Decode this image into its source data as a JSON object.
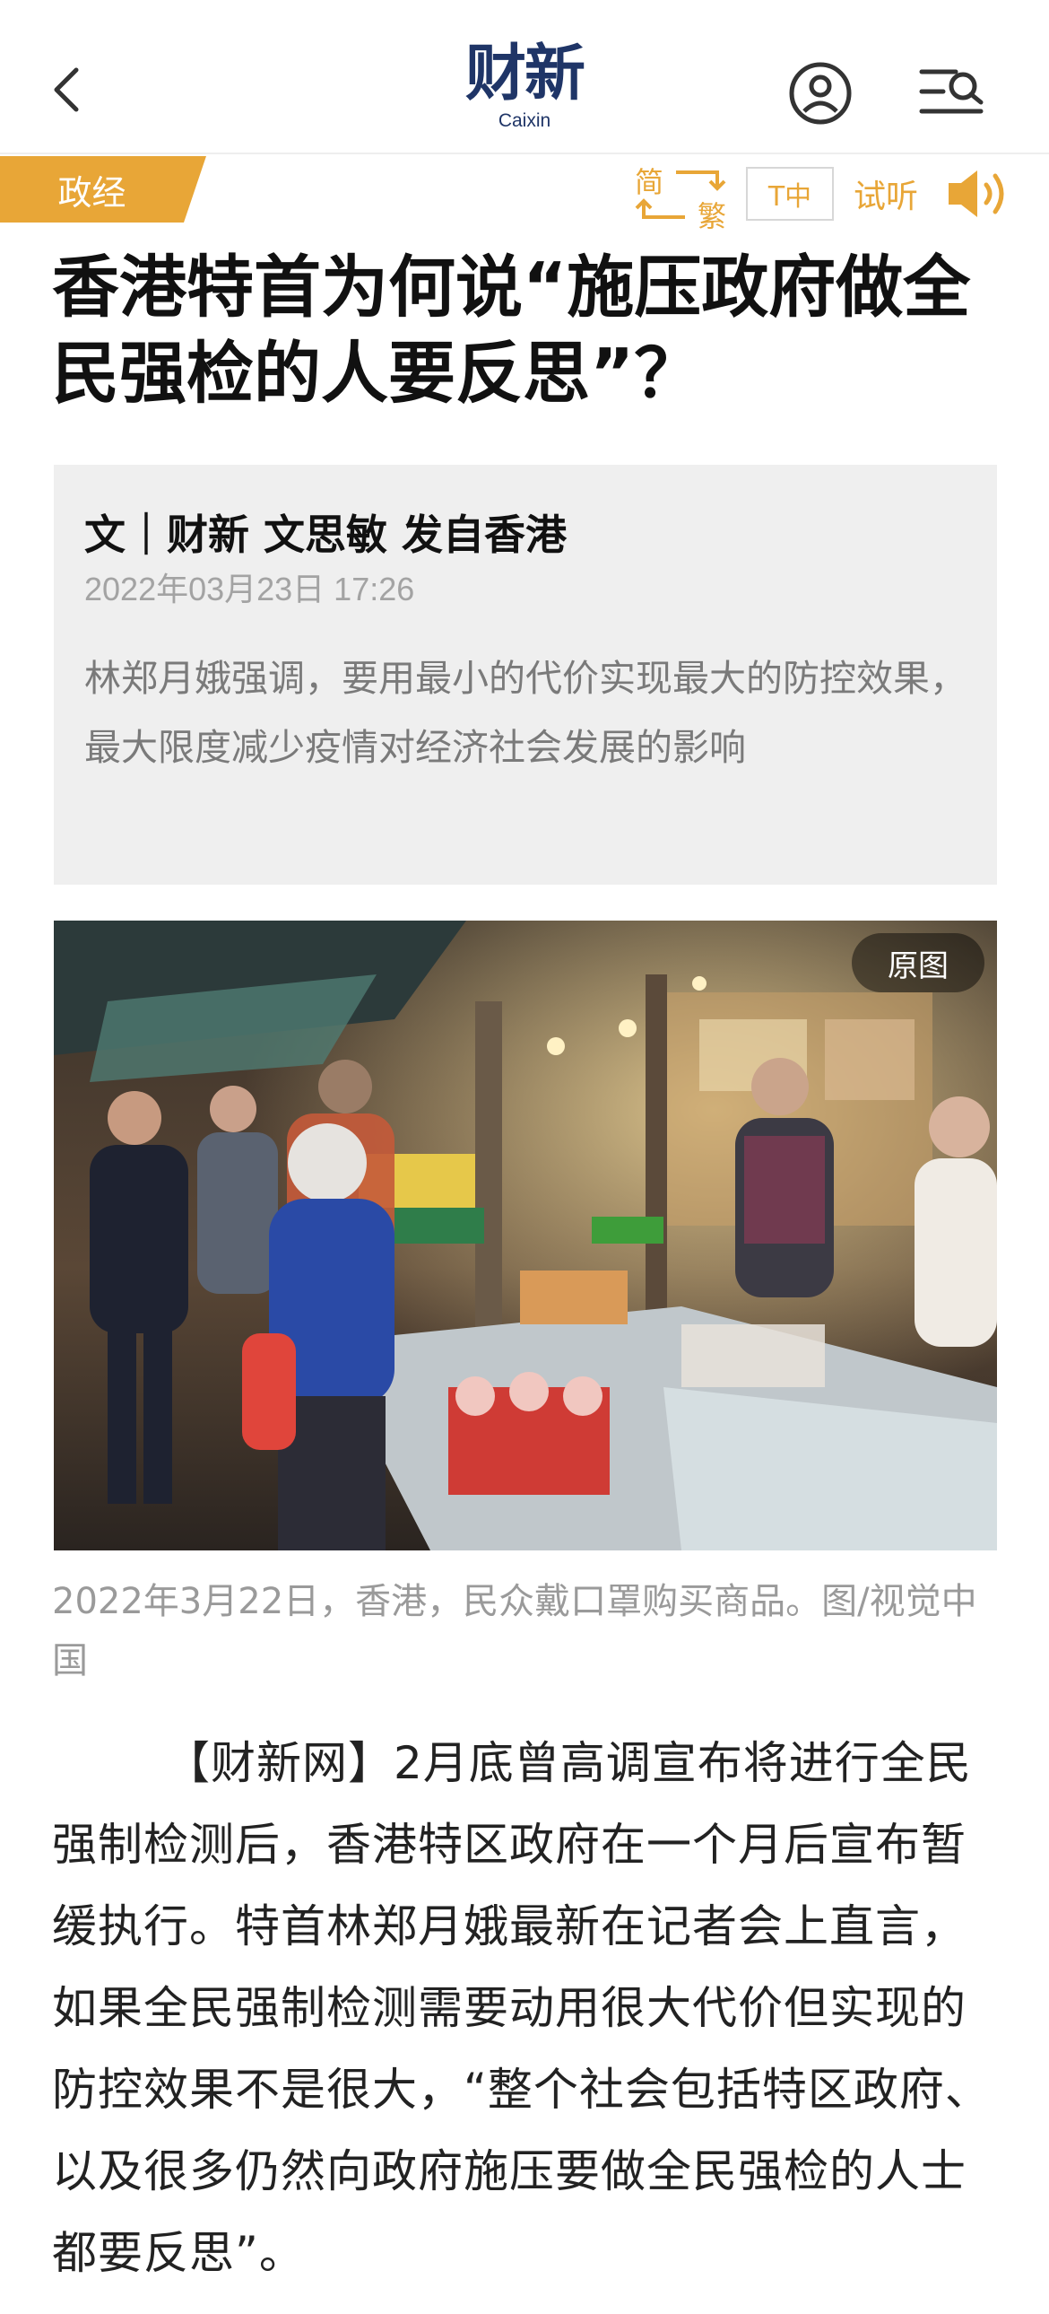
{
  "header": {
    "logo_cn": "财新",
    "logo_en": "Caixin",
    "icons": {
      "back": "chevron-left-icon",
      "user": "user-circle-icon",
      "menu": "menu-search-icon"
    }
  },
  "toolbar": {
    "category": "政经",
    "simplified": "简",
    "traditional": "繁",
    "font_size_label": "T中",
    "listen_label": "试听",
    "accent_color": "#e8a637"
  },
  "article": {
    "title": "香港特首为何说“施压政府做全民强检的人要反思”？",
    "byline": "文｜财新 文思敏 发自香港",
    "date": "2022年03月23日 17:26",
    "summary": "林郑月娥强调，要用最小的代价实现最大的防控效果，最大限度减少疫情对经济社会发展的影响",
    "image": {
      "original_label": "原图"
    },
    "caption": "2022年3月22日，香港，民众戴口罩购买商品。图/视觉中国",
    "body": "【财新网】2月底曾高调宣布将进行全民强制检测后，香港特区政府在一个月后宣布暂缓执行。特首林郑月娥最新在记者会上直言，如果全民强制检测需要动用很大代价但实现的防控效果不是很大，“整个社会包括特区政府、以及很多仍然向政府施压要做全民强检的人士都要反思”。"
  }
}
